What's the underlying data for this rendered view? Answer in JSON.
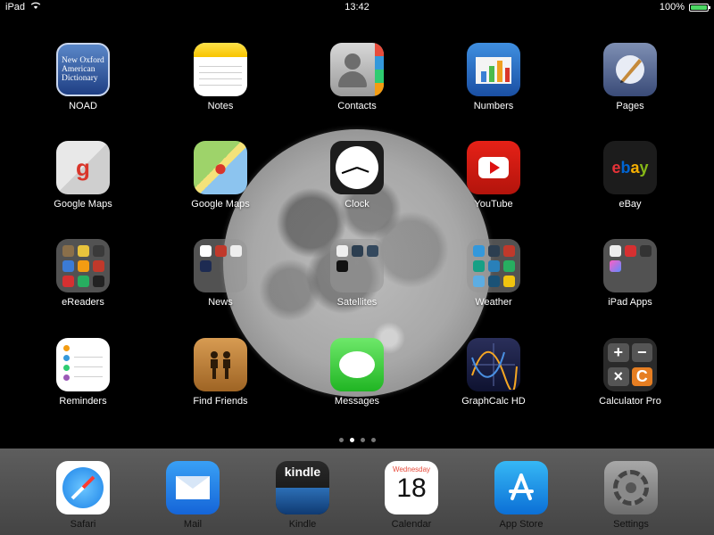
{
  "status_bar": {
    "device": "iPad",
    "time": "13:42",
    "battery": "100%",
    "battery_level": 1.0
  },
  "apps": [
    {
      "label": "NOAD",
      "icon": "oxford-dictionary-icon",
      "icon_text": "New Oxford American Dictionary"
    },
    {
      "label": "Notes",
      "icon": "notes-icon"
    },
    {
      "label": "Contacts",
      "icon": "contacts-icon"
    },
    {
      "label": "Numbers",
      "icon": "numbers-icon"
    },
    {
      "label": "Pages",
      "icon": "pages-icon"
    },
    {
      "label": "Google Maps",
      "icon": "google-maps-icon"
    },
    {
      "label": "Google Maps",
      "icon": "google-maps-icon"
    },
    {
      "label": "Clock",
      "icon": "clock-icon"
    },
    {
      "label": "YouTube",
      "icon": "youtube-icon"
    },
    {
      "label": "eBay",
      "icon": "ebay-icon",
      "icon_text": "ebay"
    },
    {
      "label": "eReaders",
      "icon": "folder-icon"
    },
    {
      "label": "News",
      "icon": "folder-icon"
    },
    {
      "label": "Satellites",
      "icon": "folder-icon"
    },
    {
      "label": "Weather",
      "icon": "folder-icon"
    },
    {
      "label": "iPad Apps",
      "icon": "folder-icon"
    },
    {
      "label": "Reminders",
      "icon": "reminders-icon"
    },
    {
      "label": "Find Friends",
      "icon": "find-friends-icon"
    },
    {
      "label": "Messages",
      "icon": "messages-icon"
    },
    {
      "label": "GraphCalc HD",
      "icon": "graphcalc-icon"
    },
    {
      "label": "Calculator Pro",
      "icon": "calculator-icon"
    }
  ],
  "page_indicator": {
    "count": 4,
    "active": 2
  },
  "dock": [
    {
      "label": "Safari",
      "icon": "safari-icon"
    },
    {
      "label": "Mail",
      "icon": "mail-icon"
    },
    {
      "label": "Kindle",
      "icon": "kindle-icon",
      "icon_text": "kindle"
    },
    {
      "label": "Calendar",
      "icon": "calendar-icon",
      "weekday": "Wednesday",
      "day": "18"
    },
    {
      "label": "App Store",
      "icon": "app-store-icon"
    },
    {
      "label": "Settings",
      "icon": "settings-icon"
    }
  ],
  "colors": {
    "battery_fill": "#4cd964",
    "dock_label": "#111111"
  }
}
